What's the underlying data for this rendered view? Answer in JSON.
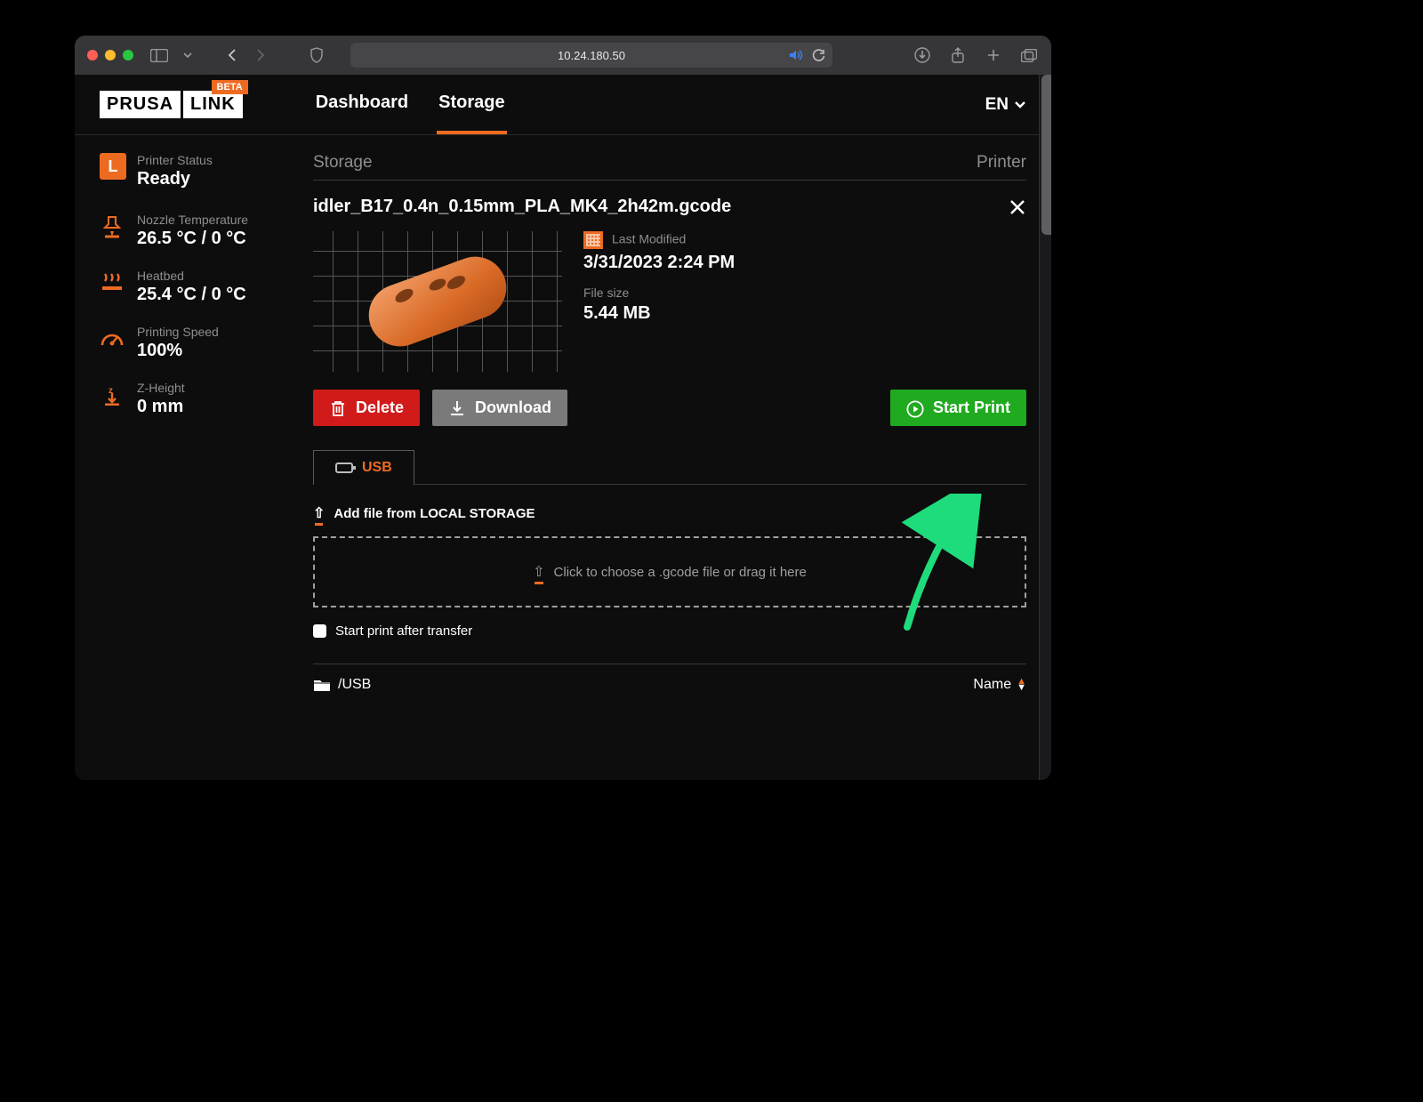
{
  "browser": {
    "address": "10.24.180.50"
  },
  "app": {
    "logo_a": "PRUSA",
    "logo_b": "LINK",
    "beta": "BETA",
    "nav": {
      "dashboard": "Dashboard",
      "storage": "Storage"
    },
    "lang": "EN"
  },
  "sidebar": {
    "status_label": "Printer Status",
    "status_value": "Ready",
    "status_badge": "L",
    "nozzle_label": "Nozzle Temperature",
    "nozzle_value": "26.5 °C / 0 °C",
    "heatbed_label": "Heatbed",
    "heatbed_value": "25.4 °C / 0 °C",
    "speed_label": "Printing Speed",
    "speed_value": "100%",
    "zheight_label": "Z-Height",
    "zheight_value": "0 mm"
  },
  "panel": {
    "head_left": "Storage",
    "head_right": "Printer",
    "file_name": "idler_B17_0.4n_0.15mm_PLA_MK4_2h42m.gcode",
    "last_modified_label": "Last Modified",
    "last_modified_value": "3/31/2023 2:24 PM",
    "file_size_label": "File size",
    "file_size_value": "5.44 MB",
    "delete": "Delete",
    "download": "Download",
    "start_print": "Start Print",
    "tab_usb": "USB",
    "add_file": "Add file from LOCAL STORAGE",
    "dropzone": "Click to choose a .gcode file or drag it here",
    "cb_label": "Start print after transfer",
    "path": "/USB",
    "sort_label": "Name"
  }
}
